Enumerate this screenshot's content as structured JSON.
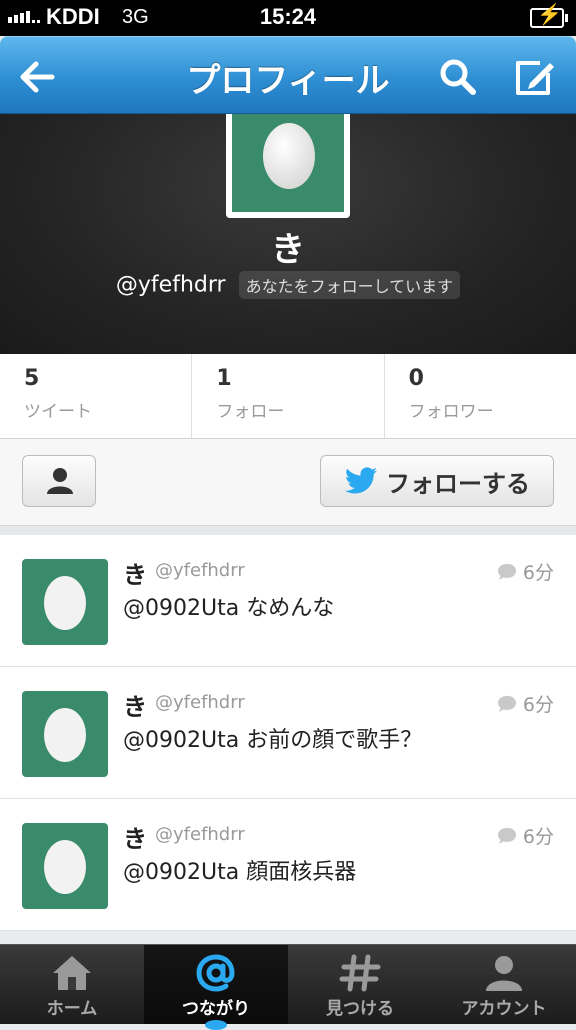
{
  "status_bar": {
    "carrier": "KDDI",
    "network": "3G",
    "time": "15:24"
  },
  "nav": {
    "title": "プロフィール",
    "icons": [
      "back-arrow-icon",
      "search-icon",
      "compose-icon"
    ]
  },
  "profile": {
    "name": "き",
    "handle": "@yfefhdrr",
    "follows_you": "あなたをフォローしています"
  },
  "stats": [
    {
      "count": "5",
      "label": "ツイート"
    },
    {
      "count": "1",
      "label": "フォロー"
    },
    {
      "count": "0",
      "label": "フォロワー"
    }
  ],
  "actions": {
    "follow_label": "フォローする"
  },
  "tweets": [
    {
      "name": "き",
      "handle": "@yfefhdrr",
      "time": "6分",
      "text": "@0902Uta なめんな"
    },
    {
      "name": "き",
      "handle": "@yfefhdrr",
      "time": "6分",
      "text": "@0902Uta お前の顔で歌手？"
    },
    {
      "name": "き",
      "handle": "@yfefhdrr",
      "time": "6分",
      "text": "@0902Uta 顔面核兵器"
    }
  ],
  "tabs": [
    {
      "label": "ホーム",
      "icon": "home-icon",
      "active": false
    },
    {
      "label": "つながり",
      "icon": "at-icon",
      "active": true
    },
    {
      "label": "見つける",
      "icon": "hash-icon",
      "active": false
    },
    {
      "label": "アカウント",
      "icon": "account-icon",
      "active": false
    }
  ],
  "colors": {
    "nav_blue": "#2f8fd3",
    "egg_green": "#3a8a6c",
    "twitter_blue": "#2aa8f0"
  }
}
